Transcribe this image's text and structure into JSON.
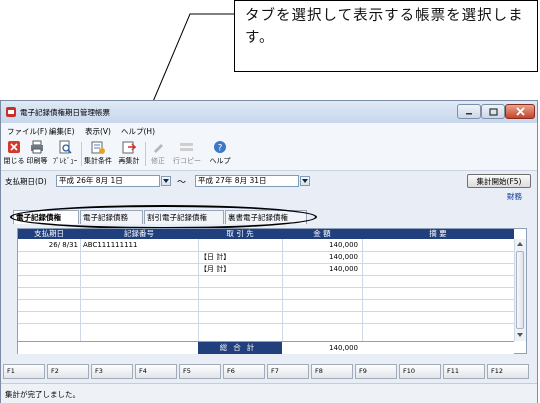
{
  "callout": {
    "text": "タブを選択して表示する帳票を選択します。"
  },
  "window": {
    "title": "電子記録債権期日管理帳票",
    "menu": [
      "ファイル(F)",
      "編集(E)",
      "表示(V)",
      "ヘルプ(H)"
    ],
    "toolbar": [
      "閉じる",
      "印刷等",
      "ﾌﾟﾚﾋﾞｭｰ",
      "集計条件",
      "再集計",
      "修正",
      "行コピー",
      "ヘルプ"
    ]
  },
  "filter": {
    "label": "支払期日(D)",
    "from": "平成 26年  8月  1日",
    "tilde": "～",
    "to": "平成 27年  8月 31日",
    "agg_button": "集計開始(F5)",
    "dept": "財務"
  },
  "tabs": [
    "電子記録債権",
    "電子記録債務",
    "割引電子記録債権",
    "裏書電子記録債権"
  ],
  "table": {
    "headers": [
      "支払期日",
      "記録番号",
      "取 引 先",
      "金  額",
      "摘    要"
    ],
    "rows": [
      {
        "date": "26/ 8/31",
        "number": "ABC111111111",
        "partner": "",
        "amount": "140,000"
      },
      {
        "date": "",
        "number": "",
        "partner": "【日     計】",
        "amount": "140,000"
      },
      {
        "date": "",
        "number": "",
        "partner": "【月     計】",
        "amount": "140,000"
      }
    ],
    "total_label": "総合計",
    "total_amount": "140,000"
  },
  "fkeys": [
    "F1",
    "F2",
    "F3",
    "F4",
    "F5",
    "F6",
    "F7",
    "F8",
    "F9",
    "F10",
    "F11",
    "F12"
  ],
  "status": "集計が完了しました。"
}
